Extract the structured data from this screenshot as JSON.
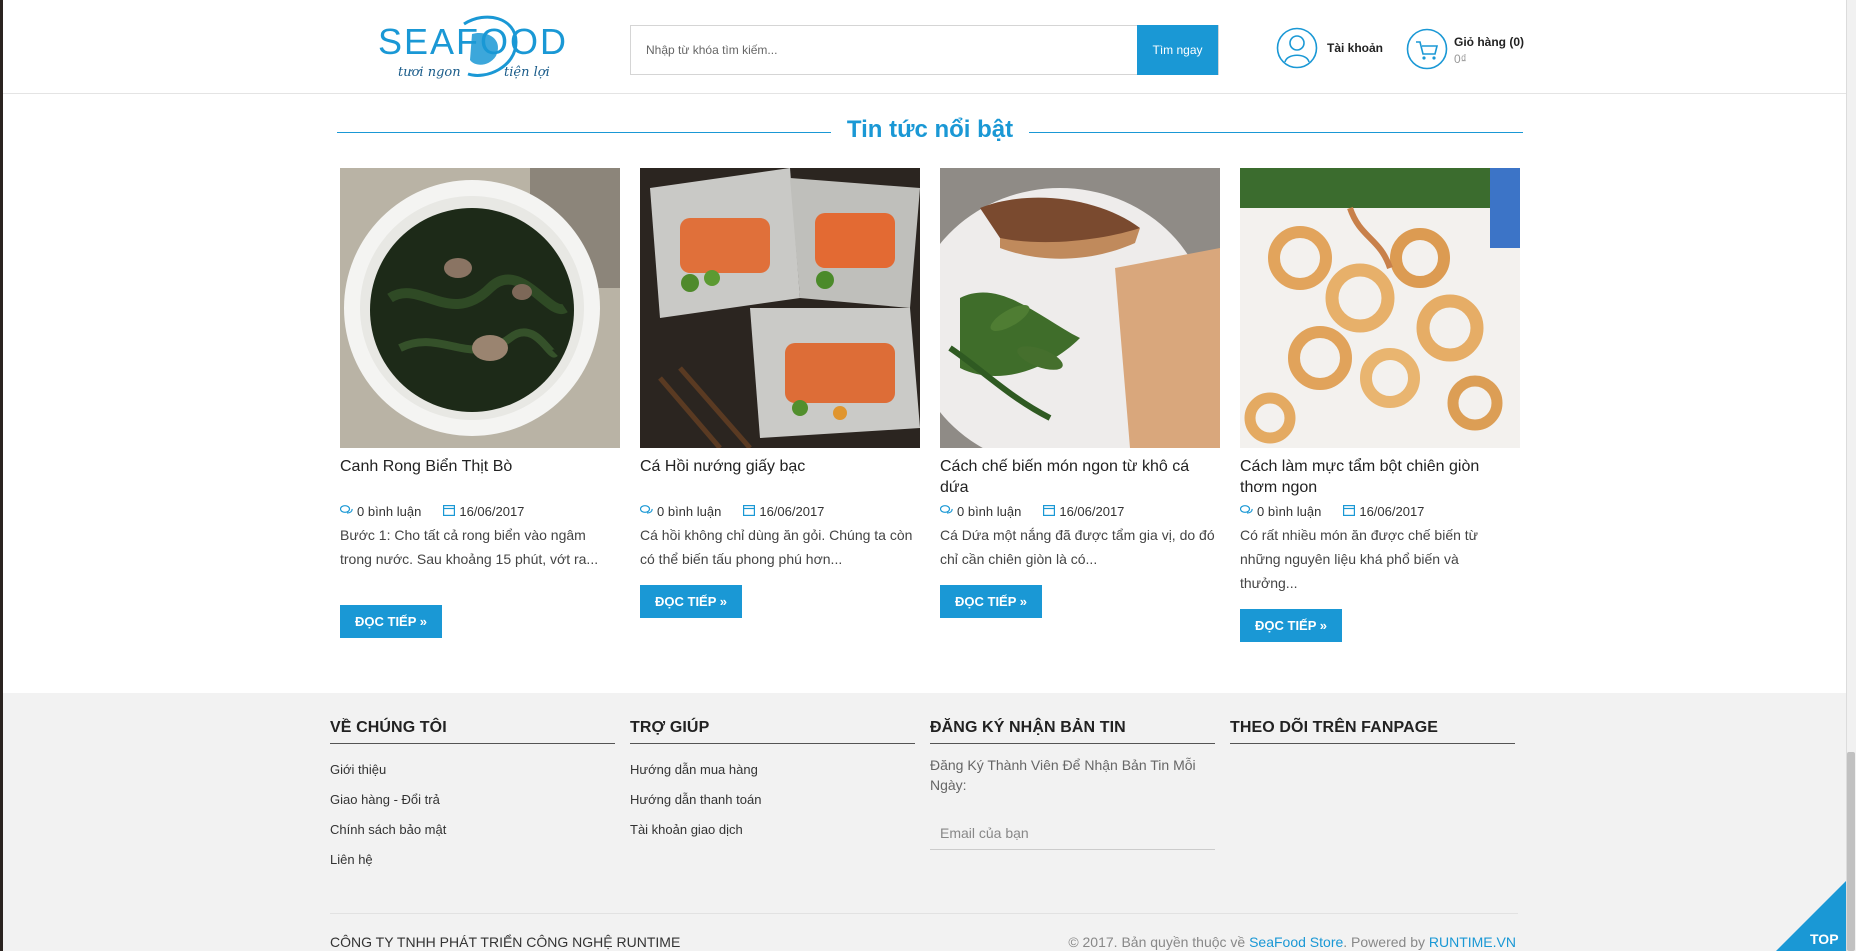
{
  "brand": {
    "logo_text": "SEAFOOD",
    "tagline_left": "tươi ngon",
    "tagline_right": "tiện lợi"
  },
  "search": {
    "placeholder": "Nhập từ khóa tìm kiếm...",
    "button_label": "Tìm ngay"
  },
  "account": {
    "label": "Tài khoản"
  },
  "cart": {
    "title": "Giỏ hàng",
    "count": "(0)",
    "total": "0₫"
  },
  "section": {
    "title": "Tin tức nổi bật"
  },
  "news": [
    {
      "title": "Canh Rong Biển Thịt Bò",
      "comments": "0 bình luận",
      "date": "16/06/2017",
      "excerpt": " Bước 1: Cho tất cả rong biển vào ngâm trong nước. Sau khoảng 15 phút, vớt ra...",
      "read_more": "ĐỌC TIẾP »"
    },
    {
      "title": "Cá Hồi nướng giấy bạc",
      "comments": "0 bình luận",
      "date": "16/06/2017",
      "excerpt": "Cá hồi không chỉ dùng ăn gỏi. Chúng ta còn có thể biến tấu phong phú hơn...",
      "read_more": "ĐỌC TIẾP »"
    },
    {
      "title": "Cách chế biến món ngon từ khô cá dứa",
      "comments": "0 bình luận",
      "date": "16/06/2017",
      "excerpt": "Cá Dứa một nắng đã được tẩm gia vị, do đó chỉ cần chiên giòn là có...",
      "read_more": "ĐỌC TIẾP »"
    },
    {
      "title": "Cách làm mực tẩm bột chiên giòn thơm ngon",
      "comments": "0 bình luận",
      "date": "16/06/2017",
      "excerpt": "Có rất nhiều món ăn được chế biến từ những nguyên liệu khá phổ biến và thưởng...",
      "read_more": "ĐỌC TIẾP »"
    }
  ],
  "footer": {
    "about": {
      "title": "VỀ CHÚNG TÔI",
      "links": [
        "Giới thiệu",
        "Giao hàng - Đổi trả",
        "Chính sách bảo mật",
        "Liên hệ"
      ]
    },
    "help": {
      "title": "TRỢ GIÚP",
      "links": [
        "Hướng dẫn mua hàng",
        "Hướng dẫn thanh toán",
        "Tài khoản giao dịch"
      ]
    },
    "newsletter": {
      "title": "ĐĂNG KÝ NHẬN BẢN TIN",
      "text": "Đăng Ký Thành Viên Để Nhận Bản Tin Mỗi Ngày:",
      "placeholder": "Email của bạn"
    },
    "fanpage": {
      "title": "THEO DÕI TRÊN FANPAGE"
    },
    "company": "CÔNG TY TNHH PHÁT TRIỂN CÔNG NGHỆ RUNTIME",
    "copyright_prefix": "© 2017. Bản quyền thuộc về ",
    "copyright_store": "SeaFood Store",
    "copyright_mid": ". Powered by ",
    "copyright_powered": "RUNTIME.VN"
  },
  "top_button": {
    "label": "TOP"
  },
  "colors": {
    "accent": "#1a98d5",
    "footer_bg": "#f2f2f2"
  },
  "icons": {
    "account": "user-icon",
    "cart": "cart-icon",
    "comment": "comments-icon",
    "date": "calendar-icon"
  }
}
